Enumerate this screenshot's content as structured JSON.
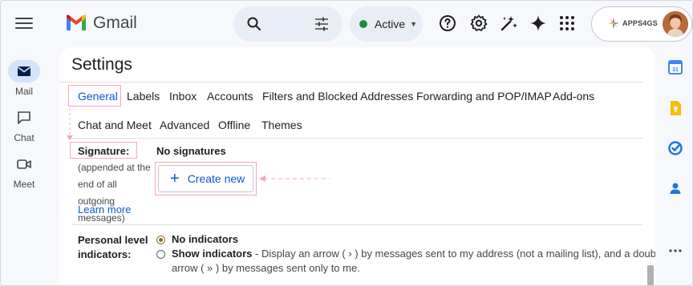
{
  "app": {
    "name": "Gmail"
  },
  "status": {
    "label": "Active"
  },
  "account": {
    "brand": "APPS4GS"
  },
  "rail": [
    {
      "label": "Mail"
    },
    {
      "label": "Chat"
    },
    {
      "label": "Meet"
    }
  ],
  "page": {
    "title": "Settings"
  },
  "tabs": [
    {
      "label": "General",
      "active": true
    },
    {
      "label": "Labels"
    },
    {
      "label": "Inbox"
    },
    {
      "label": "Accounts"
    },
    {
      "label": "Filters and Blocked Addresses"
    },
    {
      "label": "Forwarding and POP/IMAP"
    },
    {
      "label": "Add-ons"
    },
    {
      "label": "Chat and Meet"
    },
    {
      "label": "Advanced"
    },
    {
      "label": "Offline"
    },
    {
      "label": "Themes"
    }
  ],
  "signature": {
    "label": "Signature:",
    "description": "(appended at the end of all outgoing messages)",
    "learn_more": "Learn more",
    "none_text": "No signatures",
    "create_label": "Create new"
  },
  "indicators": {
    "label_line1": "Personal level",
    "label_line2": "indicators:",
    "options": [
      {
        "title": "No indicators",
        "description": "",
        "checked": true
      },
      {
        "title": "Show indicators",
        "description": " - Display an arrow ( › ) by messages sent to my address (not a mailing list), and a doub",
        "description_line2": "arrow ( » ) by messages sent only to me.",
        "checked": false
      }
    ]
  },
  "colors": {
    "accent": "#0b57d0",
    "highlight": "#f0a8c4",
    "background": "#f6f8fc",
    "active_pill": "#d3e3fd",
    "status_green": "#1e8e3e"
  },
  "icons": {
    "menu": "hamburger-icon",
    "search": "search-icon",
    "filter": "tune-icon",
    "help": "help-icon",
    "settings": "gear-icon",
    "gemini": "sparkle-icon",
    "apps": "apps-grid-icon"
  }
}
